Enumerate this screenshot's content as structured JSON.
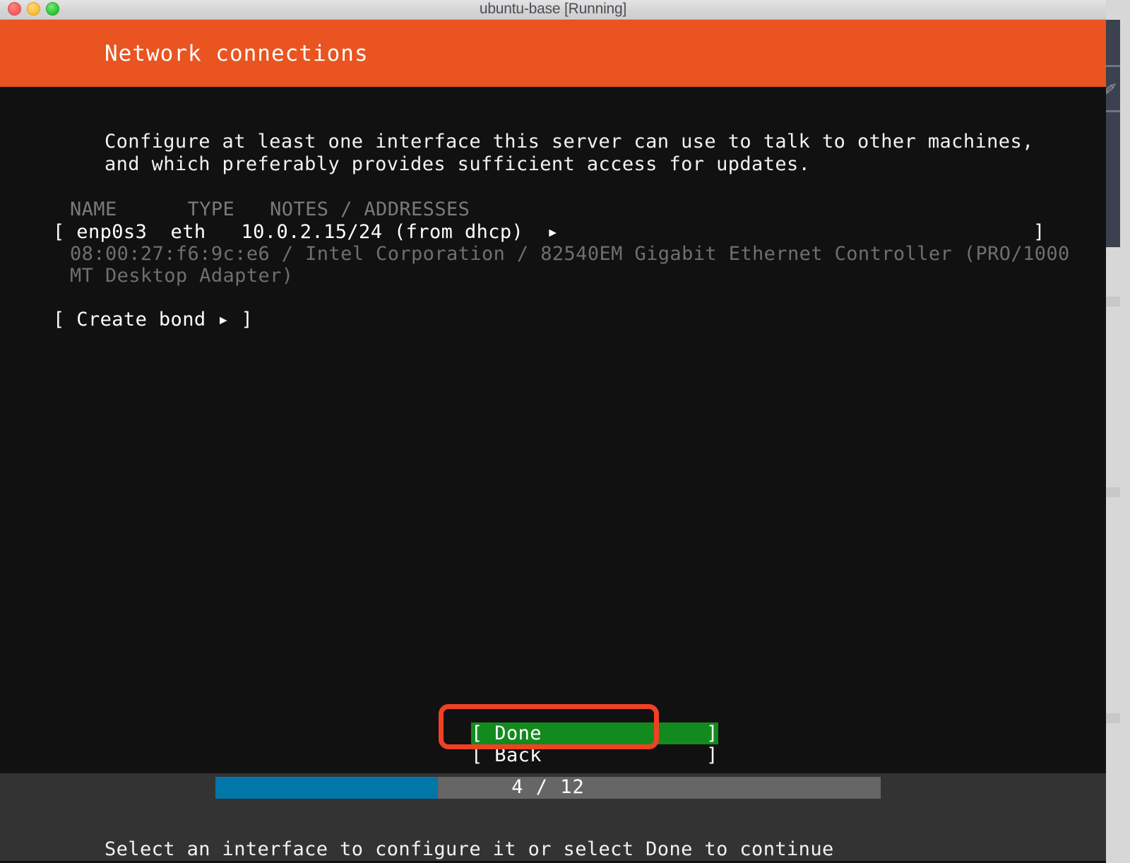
{
  "window": {
    "title": "ubuntu-base [Running]",
    "controls": [
      {
        "name": "close",
        "color": "#f1585a"
      },
      {
        "name": "minimize",
        "color": "#f9bb33"
      },
      {
        "name": "maximize",
        "color": "#27c230"
      }
    ]
  },
  "installer": {
    "header_title": "Network connections",
    "header_color": "#e95420",
    "intro_line1": "Configure at least one interface this server can use to talk to other machines,",
    "intro_line2": "and which preferably provides sufficient access for updates.",
    "table": {
      "headers_line": "NAME      TYPE   NOTES / ADDRESSES",
      "columns": [
        "NAME",
        "TYPE",
        "NOTES / ADDRESSES"
      ],
      "rows": [
        {
          "open_bracket": "[",
          "name": "enp0s3",
          "type": "eth",
          "notes": "10.0.2.15/24 (from dhcp)",
          "caret": "▸",
          "close_bracket": "]",
          "row_text": "[ enp0s3  eth   10.0.2.15/24 (from dhcp)  ▸",
          "detail_line1": "08:00:27:f6:9c:e6 / Intel Corporation / 82540EM Gigabit Ethernet Controller (PRO/1000",
          "detail_line2": "MT Desktop Adapter)"
        }
      ]
    },
    "create_bond_label": "[ Create bond ▸ ]",
    "buttons": [
      {
        "label": "[ Done              ]",
        "selected": true,
        "highlight_color": "#138a1e"
      },
      {
        "label": "[ Back              ]",
        "selected": false
      }
    ],
    "annotation_color": "#f04124",
    "progress": {
      "current": 4,
      "total": 12,
      "label": "4 / 12",
      "fill_percent": 33.4,
      "fill_color": "#0077a8",
      "track_color": "#666666"
    },
    "footer_hint": "Select an interface to configure it or select Done to continue"
  },
  "sliver": {
    "glyph": "✐"
  }
}
